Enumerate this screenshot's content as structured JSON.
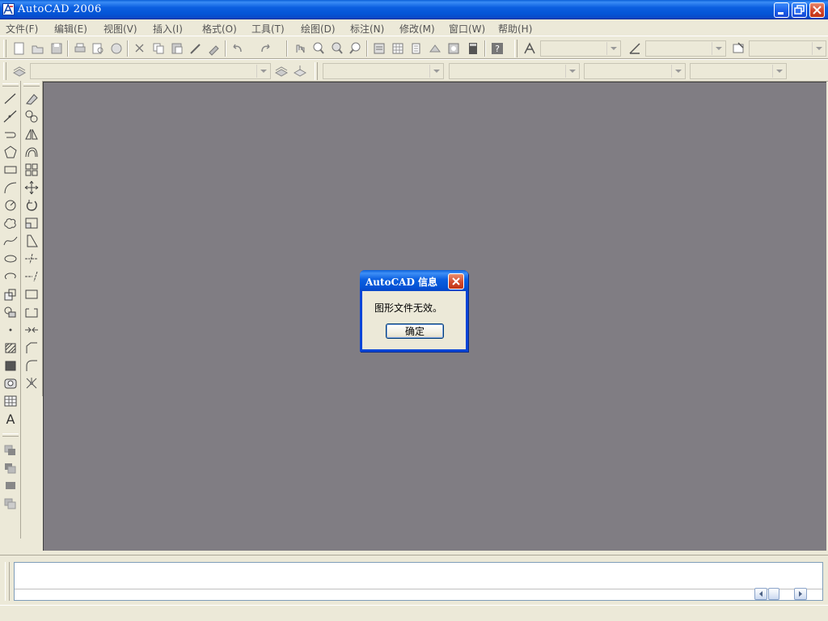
{
  "window": {
    "title": "AutoCAD 2006",
    "icon": "autocad-app-icon"
  },
  "menu": [
    "文件(F)",
    "编辑(E)",
    "视图(V)",
    "插入(I)",
    "格式(O)",
    "工具(T)",
    "绘图(D)",
    "标注(N)",
    "修改(M)",
    "窗口(W)",
    "帮助(H)"
  ],
  "dialog": {
    "title": "AutoCAD 信息",
    "message": "图形文件无效。",
    "ok_label": "确定"
  },
  "colors": {
    "canvas_bg": "#807d83",
    "titlebar_blue": "#0b5fe0",
    "close_red": "#d2452b"
  }
}
